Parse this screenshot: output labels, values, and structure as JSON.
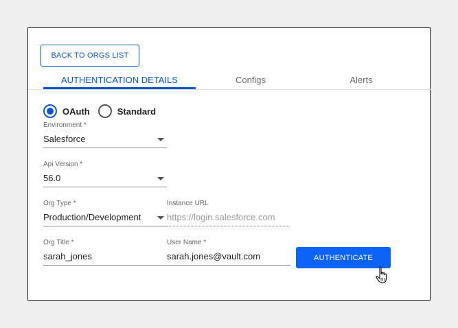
{
  "back_button": {
    "label": "BACK TO ORGS LIST"
  },
  "tabs": [
    {
      "label": "AUTHENTICATION DETAILS",
      "active": true
    },
    {
      "label": "Configs",
      "active": false
    },
    {
      "label": "Alerts",
      "active": false
    }
  ],
  "auth_type": {
    "options": [
      "OAuth",
      "Standard"
    ],
    "selected": "OAuth"
  },
  "fields": {
    "environment": {
      "label": "Environment *",
      "value": "Salesforce"
    },
    "api_version": {
      "label": "Api Version *",
      "value": "56.0"
    },
    "org_type": {
      "label": "Org Type *",
      "value": "Production/Development"
    },
    "instance_url": {
      "label": "Instance URL",
      "placeholder": "https://login.salesforce.com"
    },
    "org_title": {
      "label": "Org Title *",
      "value": "sarah_jones"
    },
    "user_name": {
      "label": "User Name *",
      "value": "sarah.jones@vault.com"
    }
  },
  "authenticate_button": {
    "label": "AUTHENTICATE"
  },
  "colors": {
    "accent": "#0b57c9",
    "button": "#0b63f6",
    "background": "#f0f0f0"
  },
  "icons": {
    "cursor": "hand-pointer-icon",
    "dropdown": "caret-down-icon"
  }
}
